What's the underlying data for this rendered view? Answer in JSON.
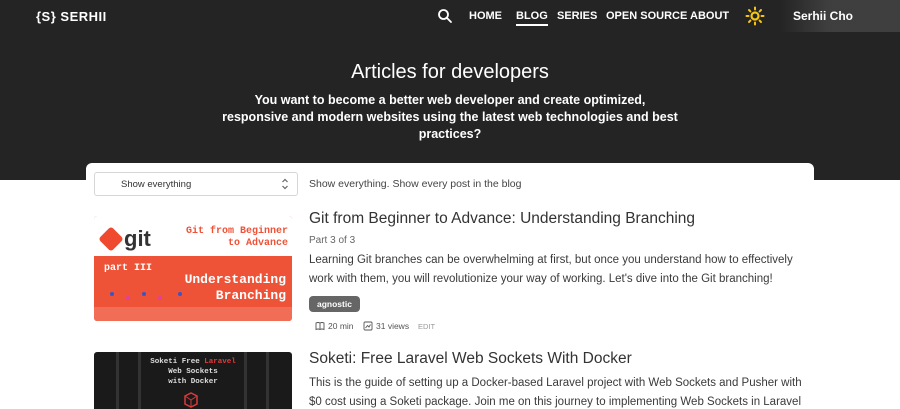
{
  "nav": {
    "logo": "{S} SERHII",
    "links": [
      {
        "label": "HOME"
      },
      {
        "label": "BLOG"
      },
      {
        "label": "SERIES"
      },
      {
        "label": "OPEN SOURCE"
      },
      {
        "label": "ABOUT"
      }
    ],
    "active": "BLOG",
    "user_name": "Serhii Cho"
  },
  "hero": {
    "title": "Articles for developers",
    "subtitle": "You want to become a better web developer and create optimized, responsive and modern websites using the latest web technologies and best practices?"
  },
  "filter": {
    "selected": "Show everything",
    "description": "Show everything.  Show every post in the blog"
  },
  "posts": [
    {
      "title": "Git from Beginner to Advance: Understanding Branching",
      "part": "Part 3 of 3",
      "description": "Learning Git branches can be overwhelming at first, but once you understand how to effectively work with them, you will revolutionize your way of working. Let's dive into the Git branching!",
      "tag": "agnostic",
      "read_time": "20 min",
      "views": "31 views",
      "edit_label": "EDIT",
      "thumb": {
        "logo_text": "git",
        "title_line1": "Git from Beginner",
        "title_line2": "to Advance",
        "part_text": "part III",
        "big_line1": "Understanding",
        "big_line2": "Branching"
      }
    },
    {
      "title": "Soketi: Free Laravel Web Sockets With Docker",
      "description": "This is the guide of setting up a Docker-based Laravel project with Web Sockets and Pusher with $0 cost using a Soketi package. Join me on this journey to implementing Web Sockets in Laravel",
      "thumb": {
        "line1a": "Soketi Free",
        "line1b": "Laravel",
        "line2": "Web Sockets",
        "line3": "with Docker"
      }
    }
  ],
  "colors": {
    "hero_bg": "#242424",
    "accent_sun": "#f5c518",
    "git_orange": "#ee5237",
    "tag_bg": "#666666"
  },
  "icons": [
    "search-icon",
    "sun-icon",
    "chevron-updown-icon",
    "book-icon",
    "views-icon"
  ]
}
